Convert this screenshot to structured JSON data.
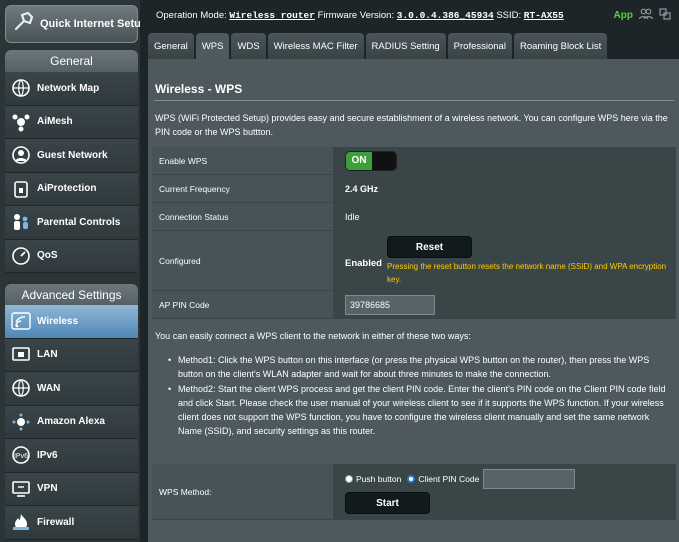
{
  "sidebar": {
    "quick_setup": "Quick Internet Setup",
    "general_heading": "General",
    "general_items": [
      {
        "label": "Network Map",
        "icon": "network-map-icon"
      },
      {
        "label": "AiMesh",
        "icon": "aimesh-icon"
      },
      {
        "label": "Guest Network",
        "icon": "guest-network-icon"
      },
      {
        "label": "AiProtection",
        "icon": "lock-icon"
      },
      {
        "label": "Parental Controls",
        "icon": "parental-controls-icon"
      },
      {
        "label": "QoS",
        "icon": "qos-gauge-icon"
      }
    ],
    "advanced_heading": "Advanced Settings",
    "advanced_items": [
      {
        "label": "Wireless",
        "icon": "wifi-icon",
        "active": true
      },
      {
        "label": "LAN",
        "icon": "lan-icon"
      },
      {
        "label": "WAN",
        "icon": "globe-icon"
      },
      {
        "label": "Amazon Alexa",
        "icon": "alexa-icon"
      },
      {
        "label": "IPv6",
        "icon": "ipv6-globe-icon"
      },
      {
        "label": "VPN",
        "icon": "vpn-icon"
      },
      {
        "label": "Firewall",
        "icon": "firewall-icon"
      }
    ]
  },
  "topbar": {
    "op_mode_label": "Operation Mode:",
    "op_mode_value": "Wireless router",
    "fw_label": "Firmware Version:",
    "fw_value": "3.0.0.4.386_45934",
    "ssid_label": "SSID:",
    "ssid_value": "RT-AX55",
    "app_label": "App"
  },
  "tabs": [
    "General",
    "WPS",
    "WDS",
    "Wireless MAC Filter",
    "RADIUS Setting",
    "Professional",
    "Roaming Block List"
  ],
  "active_tab": "WPS",
  "page": {
    "title": "Wireless - WPS",
    "description": "WPS (WiFi Protected Setup) provides easy and secure establishment of a wireless network. You can configure WPS here via the PIN code or the WPS buttton."
  },
  "settings": {
    "enable_wps_label": "Enable WPS",
    "enable_wps_value": "ON",
    "freq_label": "Current Frequency",
    "freq_value": "2.4 GHz",
    "conn_label": "Connection Status",
    "conn_value": "Idle",
    "configured_label": "Configured",
    "configured_value": "Enabled",
    "reset_button": "Reset",
    "reset_note": "Pressing the reset button resets the network name (SSID) and WPA encryption key.",
    "pin_label": "AP PIN Code",
    "pin_value": "39786685"
  },
  "instructions": {
    "intro": "You can easily connect a WPS client to the network in either of these two ways:",
    "method1": "Method1: Click the WPS button on this interface (or press the physical WPS button on the router), then press the WPS button on the client's WLAN adapter and wait for about three minutes to make the connection.",
    "method2": "Method2: Start the client WPS process and get the client PIN code. Enter the client's PIN code on the Client PIN code field and click Start. Please check the user manual of your wireless client to see if it supports the WPS function. If your wireless client does not support the WPS function, you have to configure the wireless client manually and set the same network Name (SSID), and security settings as this router."
  },
  "wps_method": {
    "label": "WPS Method:",
    "option_push": "Push button",
    "option_pin": "Client PIN Code",
    "selected": "Client PIN Code",
    "client_pin_value": "",
    "start_button": "Start"
  },
  "colors": {
    "accent_on": "#3d9f3a",
    "warning_text": "#ffcc00",
    "app_green": "#58d332",
    "active_menu": "#5b8fbd"
  }
}
